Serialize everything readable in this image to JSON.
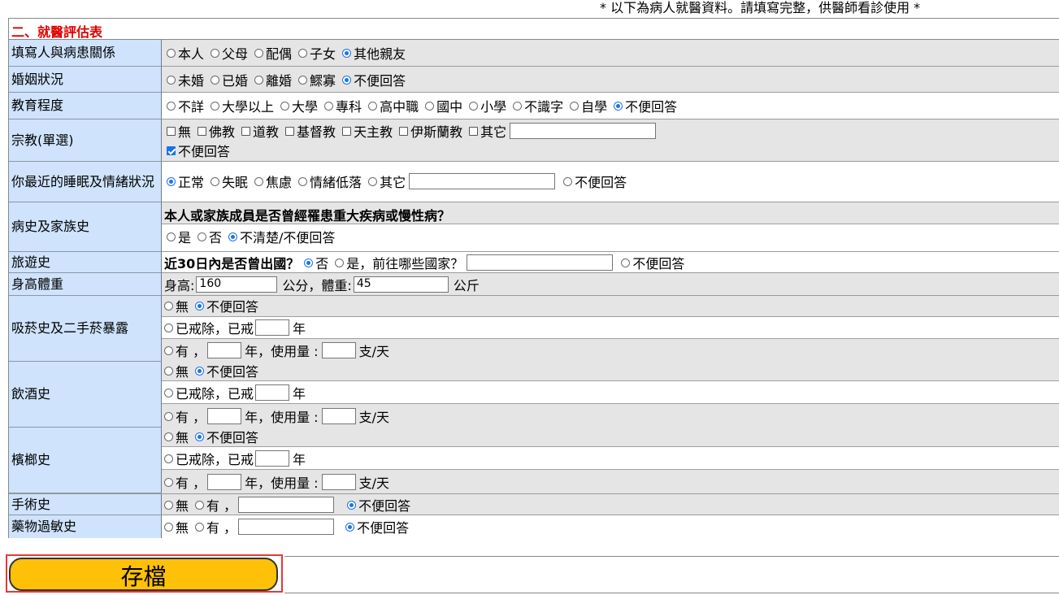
{
  "notice": "* 以下為病人就醫資料。請填寫完整，供醫師看診使用 *",
  "section_title": "二、就醫評估表",
  "rows": {
    "relation": {
      "label": "填寫人與病患關係",
      "options": [
        "本人",
        "父母",
        "配偶",
        "子女",
        "其他親友"
      ]
    },
    "marital": {
      "label": "婚姻狀況",
      "options": [
        "未婚",
        "已婚",
        "離婚",
        "鰥寡",
        "不便回答"
      ]
    },
    "education": {
      "label": "教育程度",
      "options": [
        "不詳",
        "大學以上",
        "大學",
        "專科",
        "高中職",
        "國中",
        "小學",
        "不識字",
        "自學",
        "不便回答"
      ]
    },
    "religion": {
      "label": "宗教(單選)",
      "options": [
        "無",
        "佛教",
        "道教",
        "基督教",
        "天主教",
        "伊斯蘭教",
        "其它"
      ],
      "decline": "不便回答"
    },
    "sleep": {
      "label": "你最近的睡眠及情緒狀況",
      "options": [
        "正常",
        "失眠",
        "焦慮",
        "情緒低落",
        "其它"
      ],
      "decline": "不便回答"
    },
    "history": {
      "label": "病史及家族史",
      "question": "本人或家族成員是否曾經罹患重大疾病或慢性病？",
      "options": [
        "是",
        "否",
        "不清楚/不便回答"
      ]
    },
    "travel": {
      "label": "旅遊史",
      "question": "近30日內是否曾出國？",
      "opt_no": "否",
      "opt_yes": "是，前往哪些國家？",
      "decline": "不便回答"
    },
    "body": {
      "label": "身高體重",
      "height_label": "身高:",
      "height_value": "160",
      "height_unit": "公分，體重:",
      "weight_value": "45",
      "weight_unit": "公斤"
    },
    "smoking": {
      "label": "吸菸史及二手菸暴露",
      "none": "無",
      "decline": "不便回答",
      "quit": "已戒除，已戒",
      "year": "年",
      "yes": "有 ，",
      "year_use": "年，使用量 :",
      "per_day": "支/天"
    },
    "drinking": {
      "label": "飲酒史",
      "none": "無",
      "decline": "不便回答",
      "quit": "已戒除，已戒",
      "year": "年",
      "yes": "有 ，",
      "year_use": "年，使用量 :",
      "per_day": "支/天"
    },
    "betel": {
      "label": "檳榔史",
      "none": "無",
      "decline": "不便回答",
      "quit": "已戒除，已戒",
      "year": "年",
      "yes": "有 ，",
      "year_use": "年，使用量 :",
      "per_day": "支/天"
    },
    "surgery": {
      "label": "手術史",
      "none": "無",
      "yes": "有 ，",
      "decline": "不便回答"
    },
    "allergy": {
      "label": "藥物過敏史",
      "none": "無",
      "yes": "有 ，",
      "decline": "不便回答"
    }
  },
  "save_button": "存檔",
  "colors": {
    "label_bg": "#cfe3fc",
    "value_bg": "#e5e5e5",
    "title_red": "#e00000",
    "button": "#ffc107",
    "highlight": "#e53935",
    "radio_accent": "#1a73e8"
  }
}
